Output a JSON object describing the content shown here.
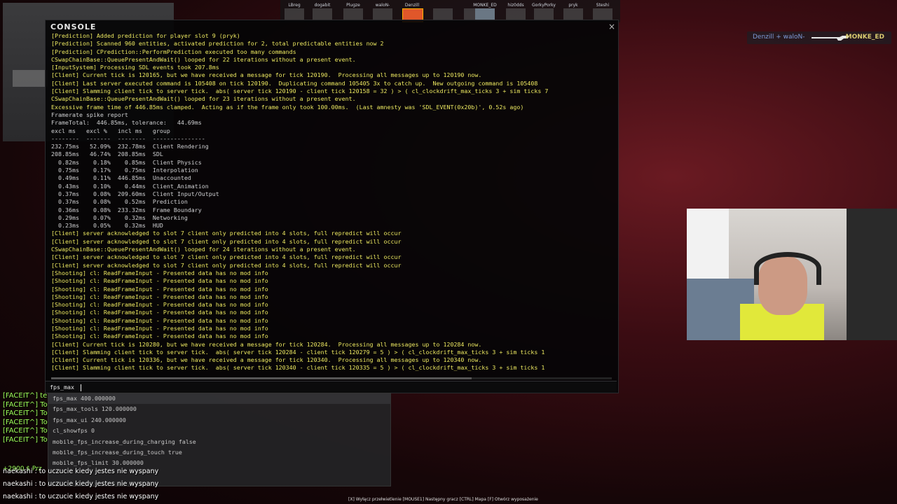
{
  "topbar": {
    "players": [
      {
        "name": "LBreg"
      },
      {
        "name": "dogabit"
      },
      {
        "name": "Plugze"
      },
      {
        "name": "waloN-"
      },
      {
        "name": "Denzill"
      },
      {
        "name": ""
      },
      {
        "name": ""
      },
      {
        "name": "MONKE_ED"
      },
      {
        "name": "hiz0dds"
      },
      {
        "name": "GorkyPorky"
      },
      {
        "name": "pryk"
      },
      {
        "name": "Steshi"
      }
    ]
  },
  "killfeed": {
    "attacker": "Denzill + waloN-",
    "weapon_icon": "rifle-icon",
    "victim": "MONKE_ED"
  },
  "console": {
    "title": "CONSOLE",
    "close_label": "×",
    "lines": [
      {
        "c": "y",
        "t": "[Prediction] Added prediction for player slot 9 (pryk)"
      },
      {
        "c": "y",
        "t": "[Prediction] Scanned 960 entities, activated prediction for 2, total predictable entities now 2"
      },
      {
        "c": "y",
        "t": "[Prediction] CPrediction::PerformPrediction executed too many commands"
      },
      {
        "c": "y",
        "t": "CSwapChainBase::QueuePresentAndWait() looped for 22 iterations without a present event."
      },
      {
        "c": "y",
        "t": "[InputSystem] Processing SDL events took 207.8ms"
      },
      {
        "c": "y",
        "t": "[Client] Current tick is 120165, but we have received a message for tick 120190.  Processing all messages up to 120190 now."
      },
      {
        "c": "y",
        "t": "[Client] Last server executed command is 105408 on tick 120190.  Duplicating command 105405 3x to catch up.  New outgoing command is 105408"
      },
      {
        "c": "y",
        "t": "[Client] Slamming client tick to server tick.  abs( server tick 120190 - client tick 120158 = 32 ) > ( cl_clockdrift_max_ticks 3 + sim ticks 7"
      },
      {
        "c": "y",
        "t": "CSwapChainBase::QueuePresentAndWait() looped for 23 iterations without a present event."
      },
      {
        "c": "y",
        "t": "Excessive frame time of 446.85ms clamped.  Acting as if the frame only took 100.00ms.  (Last amnesty was 'SDL_EVENT(0x20b)', 0.52s ago)"
      },
      {
        "c": "w",
        "t": "Framerate spike report"
      },
      {
        "c": "w",
        "t": "FrameTotal:  446.85ms, tolerance:   44.69ms"
      },
      {
        "c": "w",
        "t": "excl ms   excl %   incl ms   group"
      },
      {
        "c": "w",
        "t": "--------  -------  --------  ---------------"
      },
      {
        "c": "w",
        "t": "232.75ms   52.09%  232.78ms  Client Rendering"
      },
      {
        "c": "w",
        "t": "208.85ms   46.74%  208.85ms  SDL"
      },
      {
        "c": "w",
        "t": "  0.82ms    0.18%    0.85ms  Client Physics"
      },
      {
        "c": "w",
        "t": "  0.75ms    0.17%    0.75ms  Interpolation"
      },
      {
        "c": "w",
        "t": "  0.49ms    0.11%  446.85ms  Unaccounted"
      },
      {
        "c": "w",
        "t": "  0.43ms    0.10%    0.44ms  Client_Animation"
      },
      {
        "c": "w",
        "t": "  0.37ms    0.08%  209.60ms  Client Input/Output"
      },
      {
        "c": "w",
        "t": "  0.37ms    0.08%    0.52ms  Prediction"
      },
      {
        "c": "w",
        "t": "  0.36ms    0.08%  233.32ms  Frame Boundary"
      },
      {
        "c": "w",
        "t": "  0.29ms    0.07%    0.32ms  Networking"
      },
      {
        "c": "w",
        "t": "  0.23ms    0.05%    0.32ms  HUD"
      },
      {
        "c": "y",
        "t": "[Client] server acknowledged to slot 7 client only predicted into 4 slots, full repredict will occur"
      },
      {
        "c": "y",
        "t": "[Client] server acknowledged to slot 7 client only predicted into 4 slots, full repredict will occur"
      },
      {
        "c": "y",
        "t": "CSwapChainBase::QueuePresentAndWait() looped for 24 iterations without a present event."
      },
      {
        "c": "y",
        "t": "[Client] server acknowledged to slot 7 client only predicted into 4 slots, full repredict will occur"
      },
      {
        "c": "y",
        "t": "[Client] server acknowledged to slot 7 client only predicted into 4 slots, full repredict will occur"
      },
      {
        "c": "y",
        "t": "[Shooting] cl: ReadFrameInput - Presented data has no mod info"
      },
      {
        "c": "y",
        "t": "[Shooting] cl: ReadFrameInput - Presented data has no mod info"
      },
      {
        "c": "y",
        "t": "[Shooting] cl: ReadFrameInput - Presented data has no mod info"
      },
      {
        "c": "y",
        "t": "[Shooting] cl: ReadFrameInput - Presented data has no mod info"
      },
      {
        "c": "y",
        "t": "[Shooting] cl: ReadFrameInput - Presented data has no mod info"
      },
      {
        "c": "y",
        "t": "[Shooting] cl: ReadFrameInput - Presented data has no mod info"
      },
      {
        "c": "y",
        "t": "[Shooting] cl: ReadFrameInput - Presented data has no mod info"
      },
      {
        "c": "y",
        "t": "[Shooting] cl: ReadFrameInput - Presented data has no mod info"
      },
      {
        "c": "y",
        "t": "[Shooting] cl: ReadFrameInput - Presented data has no mod info"
      },
      {
        "c": "y",
        "t": "[Client] Current tick is 120280, but we have received a message for tick 120284.  Processing all messages up to 120284 now."
      },
      {
        "c": "y",
        "t": "[Client] Slamming client tick to server tick.  abs( server tick 120284 - client tick 120279 = 5 ) > ( cl_clockdrift_max_ticks 3 + sim ticks 1"
      },
      {
        "c": "y",
        "t": "[Client] Current tick is 120336, but we have received a message for tick 120340.  Processing all messages up to 120340 now."
      },
      {
        "c": "y",
        "t": "[Client] Slamming client tick to server tick.  abs( server tick 120340 - client tick 120335 = 5 ) > ( cl_clockdrift_max_ticks 3 + sim ticks 1"
      }
    ],
    "input_value": "fps_max ",
    "suggestions": [
      "fps_max 400.000000",
      "fps_max_tools 120.000000",
      "fps_max_ui 240.000000",
      "cl_showfps 0",
      "mobile_fps_increase_during_charging false",
      "mobile_fps_increase_during_touch true",
      "mobile_fps_limit 30.000000"
    ]
  },
  "chat": {
    "lines": [
      "[FACEIT^] te",
      "[FACEIT^] To",
      "[FACEIT^] To",
      "[FACEIT^] To",
      "[FACEIT^] To",
      "[FACEIT^] To"
    ],
    "money": "+2900 $ Prz",
    "messages": [
      "naekashi : to uczucie kiedy jestes nie wyspany",
      "naekashi : to uczucie kiedy jestes nie wyspany",
      "naekashi : to uczucie kiedy jestes nie wyspany"
    ]
  },
  "hint": "[X] Wyłącz przełwietlenie    [MOUSE1] Następny gracz    [CTRL] Mapa    [F] Otwórz wyposażenie"
}
